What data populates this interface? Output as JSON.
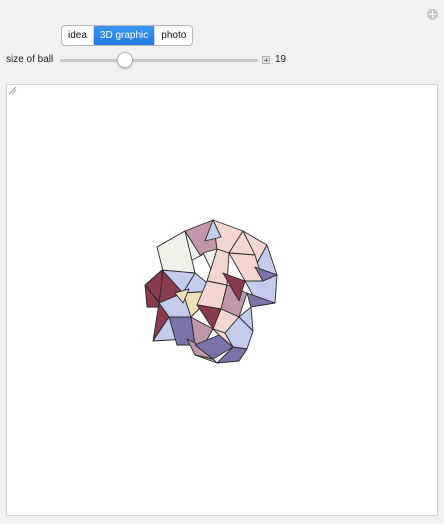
{
  "toolbar": {
    "tabs": [
      {
        "label": "idea",
        "active": false
      },
      {
        "label": "3D graphic",
        "active": true
      },
      {
        "label": "photo",
        "active": false
      }
    ],
    "active_color": "#1f79e3"
  },
  "slider": {
    "label": "size of ball",
    "value": "19",
    "position_fraction": 0.33
  },
  "graphic": {
    "description_icon": "polyhedron-ring",
    "face_colors": [
      "#f2d6cf",
      "#c4ccee",
      "#c096aa",
      "#8a3b4d",
      "#7a72a8",
      "#eef2e8",
      "#efe0b8"
    ]
  }
}
